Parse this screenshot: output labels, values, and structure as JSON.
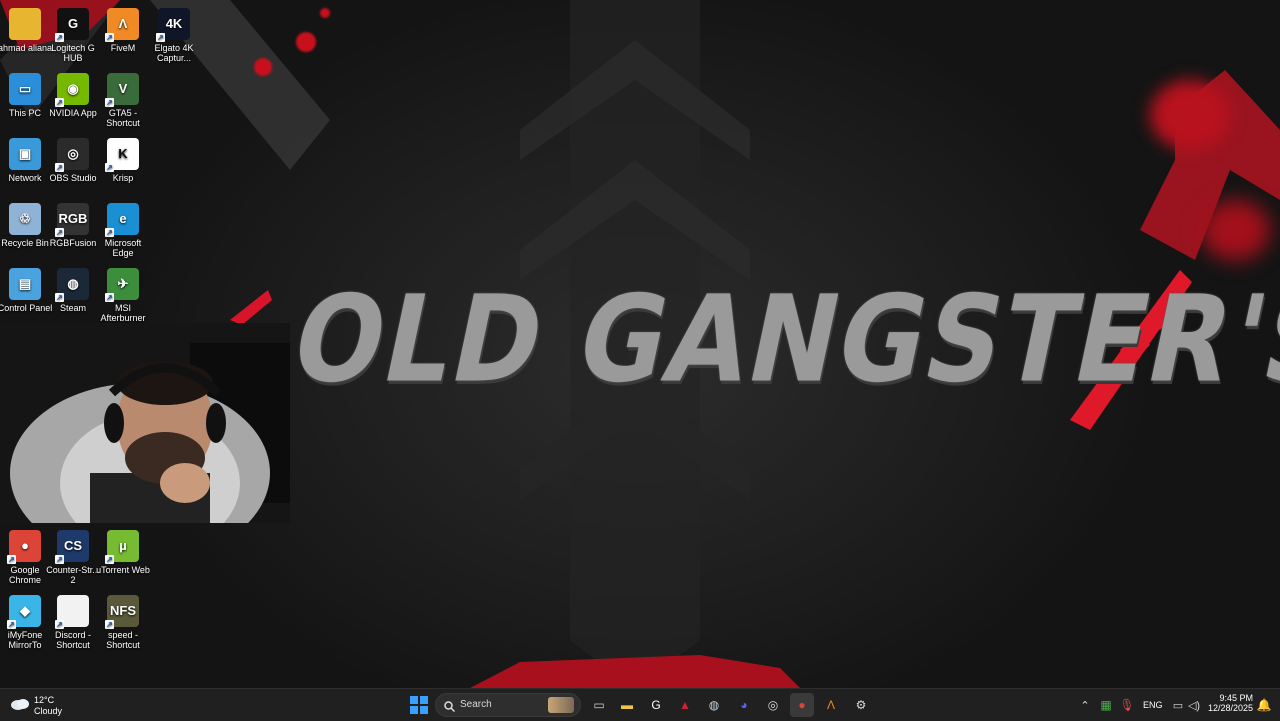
{
  "wallpaper": {
    "title": "OLD GANGSTER'S"
  },
  "desktop_icons": [
    {
      "id": "ahmad-aliana",
      "label": "ahmad aliana",
      "glyph": "",
      "color": "#e8b530",
      "shortcut": false
    },
    {
      "id": "logitech-g-hub",
      "label": "Logitech G HUB",
      "glyph": "G",
      "color": "#111111",
      "shortcut": true
    },
    {
      "id": "fivem",
      "label": "FiveM",
      "glyph": "Λ",
      "color": "#f08a24",
      "shortcut": true
    },
    {
      "id": "elgato-4k",
      "label": "Elgato 4K Captur...",
      "glyph": "4K",
      "color": "#0f1628",
      "shortcut": true
    },
    {
      "id": "this-pc",
      "label": "This PC",
      "glyph": "▭",
      "color": "#2a8fd8",
      "shortcut": false
    },
    {
      "id": "nvidia-app",
      "label": "NVIDIA App",
      "glyph": "◉",
      "color": "#76b900",
      "shortcut": true
    },
    {
      "id": "gta5",
      "label": "GTA5 - Shortcut",
      "glyph": "V",
      "color": "#3a6b3a",
      "shortcut": true
    },
    {
      "id": "network",
      "label": "Network",
      "glyph": "▣",
      "color": "#3a9ad9",
      "shortcut": false
    },
    {
      "id": "obs-studio",
      "label": "OBS Studio",
      "glyph": "◎",
      "color": "#2b2b2b",
      "shortcut": true
    },
    {
      "id": "krisp",
      "label": "Krisp",
      "glyph": "K",
      "color": "#ffffff",
      "shortcut": true
    },
    {
      "id": "recycle-bin",
      "label": "Recycle Bin",
      "glyph": "♲",
      "color": "#8fb3d6",
      "shortcut": false
    },
    {
      "id": "rgbfusion",
      "label": "RGBFusion",
      "glyph": "RGB",
      "color": "#333333",
      "shortcut": true
    },
    {
      "id": "microsoft-edge",
      "label": "Microsoft Edge",
      "glyph": "e",
      "color": "#1b8fd4",
      "shortcut": true
    },
    {
      "id": "control-panel",
      "label": "Control Panel",
      "glyph": "▤",
      "color": "#4aa3df",
      "shortcut": false
    },
    {
      "id": "steam",
      "label": "Steam",
      "glyph": "◍",
      "color": "#1b2838",
      "shortcut": true
    },
    {
      "id": "msi-afterburner",
      "label": "MSI Afterburner",
      "glyph": "✈",
      "color": "#3c8d3c",
      "shortcut": true
    },
    {
      "id": "google-chrome",
      "label": "Google Chrome",
      "glyph": "●",
      "color": "#db4437",
      "shortcut": true
    },
    {
      "id": "counter-strike-2",
      "label": "Counter-Str... 2",
      "glyph": "CS",
      "color": "#1e3a6b",
      "shortcut": true
    },
    {
      "id": "utorrent-web",
      "label": "uTorrent Web",
      "glyph": "µ",
      "color": "#77bb33",
      "shortcut": true
    },
    {
      "id": "imyfone-mirrorto",
      "label": "iMyFone MirrorTo",
      "glyph": "◆",
      "color": "#39b5e8",
      "shortcut": true
    },
    {
      "id": "discord-shortcut",
      "label": "Discord - Shortcut",
      "glyph": "",
      "color": "#f2f2f2",
      "shortcut": true
    },
    {
      "id": "speed-shortcut",
      "label": "speed - Shortcut",
      "glyph": "NFS",
      "color": "#5a5a3a",
      "shortcut": true
    }
  ],
  "taskbar": {
    "weather": {
      "temp": "12°C",
      "condition": "Cloudy"
    },
    "search": {
      "placeholder": "Search"
    },
    "tray": {
      "language": "ENG",
      "time": "9:45 PM",
      "date": "12/28/2025"
    },
    "pinned": [
      {
        "id": "start",
        "glyph": "⊞",
        "color": "#3aa0ff"
      },
      {
        "id": "task-view",
        "glyph": "▭",
        "color": "#d0d0d0"
      },
      {
        "id": "file-explorer",
        "glyph": "▬",
        "color": "#f4c542"
      },
      {
        "id": "logitech-g",
        "glyph": "G",
        "color": "#ffffff"
      },
      {
        "id": "rockstar-red",
        "glyph": "▲",
        "color": "#d02030"
      },
      {
        "id": "steam",
        "glyph": "◍",
        "color": "#c7d5e0"
      },
      {
        "id": "discord",
        "glyph": "◕",
        "color": "#5865f2"
      },
      {
        "id": "obs",
        "glyph": "◎",
        "color": "#dddddd"
      },
      {
        "id": "chrome",
        "glyph": "●",
        "color": "#db4437"
      },
      {
        "id": "fivem",
        "glyph": "Λ",
        "color": "#f08a24"
      },
      {
        "id": "settings",
        "glyph": "⚙",
        "color": "#dddddd"
      }
    ]
  }
}
